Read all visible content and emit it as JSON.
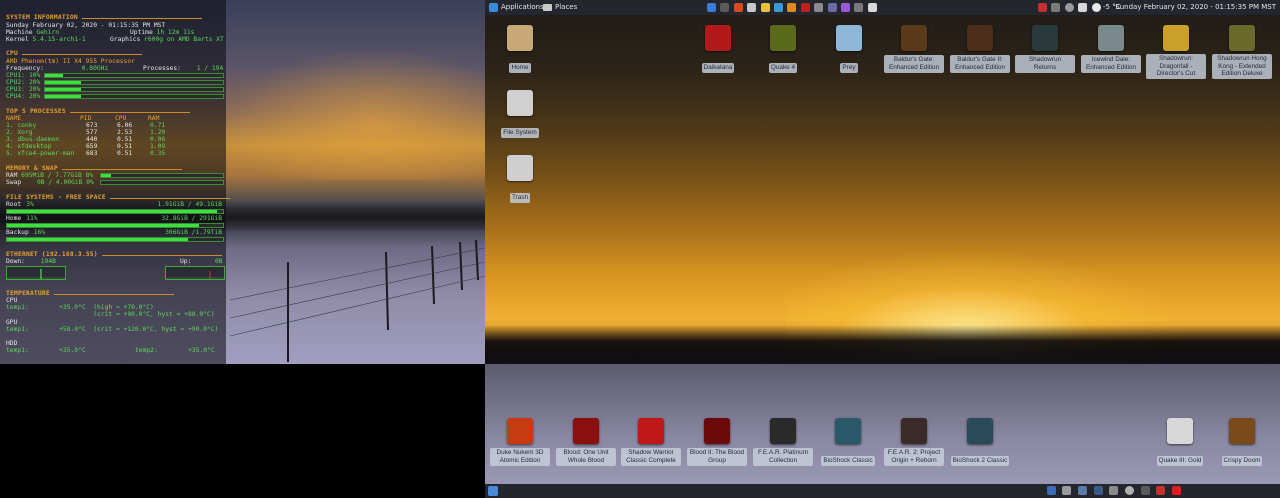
{
  "conky": {
    "sys_header": "SYSTEM INFORMATION",
    "datetime": "Sunday February 02, 2020 - 01:15:35 PM MST",
    "machine_label": "Machine",
    "machine_value": "Gehirn",
    "uptime_label": "Uptime",
    "uptime_value": "1h 12m 11s",
    "kernel_label": "Kernel",
    "kernel_value": "5.4.15-arch1-1",
    "graphics_label": "Graphics",
    "graphics_value": "r600g on AMD Barts XT",
    "cpu_header": "CPU",
    "cpu_model": "AMD Phenom(tm) II X4 955 Processor",
    "freq_label": "Frequency:",
    "freq_value": "0.80GHz",
    "proc_label": "Processes:",
    "proc_value": "1 / 194",
    "cores": [
      {
        "label": "CPU1:",
        "value": "10%",
        "level": 0.1
      },
      {
        "label": "CPU2:",
        "value": "20%",
        "level": 0.2
      },
      {
        "label": "CPU3:",
        "value": "20%",
        "level": 0.2
      },
      {
        "label": "CPU4:",
        "value": "20%",
        "level": 0.2
      }
    ],
    "top_header": "TOP 5 PROCESSES",
    "top_cols": [
      "NAME",
      "PID",
      "CPU",
      "RAM"
    ],
    "top_rows": [
      {
        "name": "1. conky",
        "pid": "673",
        "cpu": "6.06",
        "ram": "0.71"
      },
      {
        "name": "2. Xorg",
        "pid": "577",
        "cpu": "2.53",
        "ram": "1.20"
      },
      {
        "name": "3. dbus-daemon",
        "pid": "440",
        "cpu": "0.51",
        "ram": "0.06"
      },
      {
        "name": "4. xfdesktop",
        "pid": "659",
        "cpu": "0.51",
        "ram": "1.09"
      },
      {
        "name": "5. xfce4-power-man",
        "pid": "683",
        "cpu": "0.51",
        "ram": "0.35"
      }
    ],
    "mem_header": "MEMORY & SWAP",
    "ram_label": "RAM",
    "ram_value": "695MiB / 7.77GiB 8%",
    "ram_level": 0.08,
    "swap_label": "Swap",
    "swap_value": "0B / 4.00GiB 0%",
    "swap_level": 0.0,
    "fs_header": "FILE SYSTEMS - FREE SPACE",
    "fs": [
      {
        "label": "Root",
        "pct": "3%",
        "value": "1.91GiB / 49.1GiB",
        "level": 0.97
      },
      {
        "label": "Home",
        "pct": "11%",
        "value": "32.8GiB / 291GiB",
        "level": 0.89
      },
      {
        "label": "Backup",
        "pct": "16%",
        "value": "306GiB /1.79TiB",
        "level": 0.84
      }
    ],
    "net_header": "ETHERNET (192.168.3.55)",
    "down_label": "Down:",
    "down_value": "194B",
    "up_label": "Up:",
    "up_value": "0B",
    "temp_header": "TEMPERATURE",
    "cpu_temp_title": "CPU",
    "cpu_temp_l1": "temp1:        +35.0°C  (high = +70.0°C)",
    "cpu_temp_l2": "                       (crit = +90.0°C, hyst = +88.0°C)",
    "gpu_temp_title": "GPU",
    "gpu_temp_l1": "temp1:        +58.0°C  (crit = +120.0°C, hyst = +90.0°C)",
    "hdd_temp_title": "HDD",
    "hdd_temp_l1": "temp1:        +35.0°C",
    "hdd_temp_l2": "temp2:        +35.0°C"
  },
  "panel": {
    "applications": "Applications",
    "places": "Places",
    "weather": "-5 °C",
    "clock": "Sunday February 02, 2020 - 01:15:35 PM MST"
  },
  "desktop_icons_top": [
    {
      "label": "Home",
      "icon": "folder-home-icon",
      "color": "#c9a877"
    },
    {
      "label": "File System",
      "icon": "drive-icon",
      "color": "#d0d0d0"
    },
    {
      "label": "Trash",
      "icon": "trash-icon",
      "color": "#cfcfcf"
    }
  ],
  "games_top": [
    {
      "label": "Daikatana",
      "icon": "daikatana-icon",
      "color": "#b21a1a"
    },
    {
      "label": "Quake 4",
      "icon": "quake4-icon",
      "color": "#5a6a1a"
    },
    {
      "label": "Prey",
      "icon": "prey-icon",
      "color": "#8fb8d8"
    },
    {
      "label": "Baldur's Gate: Enhanced Edition",
      "icon": "baldurs-gate-icon",
      "color": "#5a3a1a"
    },
    {
      "label": "Baldur's Gate II: Enhanced Edition",
      "icon": "baldurs-gate-2-icon",
      "color": "#4a2e1a"
    },
    {
      "label": "Shadowrun Returns",
      "icon": "shadowrun-returns-icon",
      "color": "#2a3a3a"
    },
    {
      "label": "Icewind Dale: Enhanced Edition",
      "icon": "icewind-dale-icon",
      "color": "#7a8a8a"
    },
    {
      "label": "Shadowrun: Dragonfall - Director's Cut",
      "icon": "shadowrun-dragonfall-icon",
      "color": "#c8a02a"
    },
    {
      "label": "Shadowrun Hong Kong - Extended Edition Deluxe",
      "icon": "shadowrun-hongkong-icon",
      "color": "#6a6a2a"
    }
  ],
  "games_bottom": [
    {
      "label": "Duke Nukem 3D Atomic Edition",
      "icon": "duke-nukem-icon",
      "color": "#c83a10"
    },
    {
      "label": "Blood: One Unit Whole Blood",
      "icon": "blood-icon",
      "color": "#8a1010"
    },
    {
      "label": "Shadow Warrior Classic Complete",
      "icon": "shadow-warrior-icon",
      "color": "#c01818"
    },
    {
      "label": "Blood II: The Blood Group",
      "icon": "blood2-icon",
      "color": "#6a0a0a"
    },
    {
      "label": "F.E.A.R. Platinum Collection",
      "icon": "fear-icon",
      "color": "#2a2a2a"
    },
    {
      "label": "BioShock Classic",
      "icon": "bioshock-icon",
      "color": "#2a5a6a"
    },
    {
      "label": "F.E.A.R. 2: Project Origin + Reborn",
      "icon": "fear2-icon",
      "color": "#3a2a2a"
    },
    {
      "label": "BioShock 2 Classic",
      "icon": "bioshock2-icon",
      "color": "#2a4a5a"
    },
    {
      "label": "Quake III: Gold",
      "icon": "quake3-icon",
      "color": "#d8d8d8"
    },
    {
      "label": "Crispy Doom",
      "icon": "doom-icon",
      "color": "#7a4a1a"
    }
  ]
}
